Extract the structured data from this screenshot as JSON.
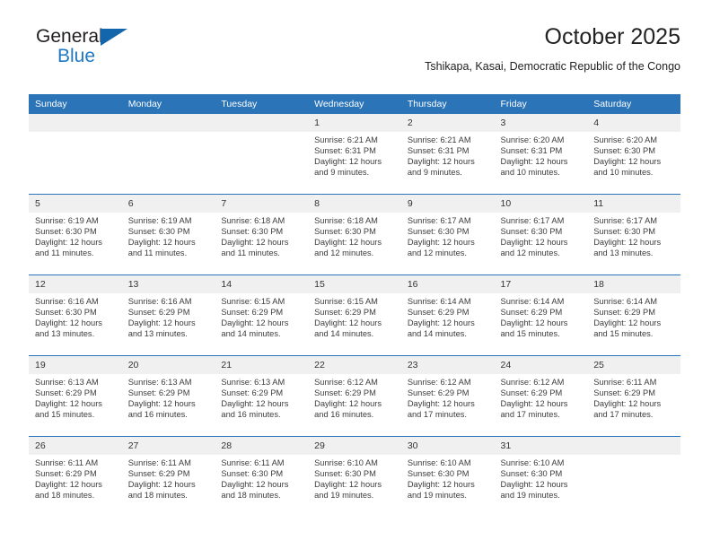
{
  "brand": {
    "name_top": "General",
    "name_bottom": "Blue",
    "accent_color": "#1366ab",
    "text_color": "#231f20",
    "blue_text_color": "#1f78c1"
  },
  "header": {
    "title": "October 2025",
    "subtitle": "Tshikapa, Kasai, Democratic Republic of the Congo"
  },
  "theme": {
    "header_row_bg": "#2b74b8",
    "header_row_text": "#ffffff",
    "daynum_bg": "#f0f0f0",
    "grid_line": "#2b74b8",
    "body_text": "#3c3c3c"
  },
  "weekdays": [
    "Sunday",
    "Monday",
    "Tuesday",
    "Wednesday",
    "Thursday",
    "Friday",
    "Saturday"
  ],
  "weeks": [
    [
      {
        "day": "",
        "sunrise": "",
        "sunset": "",
        "daylight1": "",
        "daylight2": "",
        "empty": true
      },
      {
        "day": "",
        "sunrise": "",
        "sunset": "",
        "daylight1": "",
        "daylight2": "",
        "empty": true
      },
      {
        "day": "",
        "sunrise": "",
        "sunset": "",
        "daylight1": "",
        "daylight2": "",
        "empty": true
      },
      {
        "day": "1",
        "sunrise": "Sunrise: 6:21 AM",
        "sunset": "Sunset: 6:31 PM",
        "daylight1": "Daylight: 12 hours",
        "daylight2": "and 9 minutes."
      },
      {
        "day": "2",
        "sunrise": "Sunrise: 6:21 AM",
        "sunset": "Sunset: 6:31 PM",
        "daylight1": "Daylight: 12 hours",
        "daylight2": "and 9 minutes."
      },
      {
        "day": "3",
        "sunrise": "Sunrise: 6:20 AM",
        "sunset": "Sunset: 6:31 PM",
        "daylight1": "Daylight: 12 hours",
        "daylight2": "and 10 minutes."
      },
      {
        "day": "4",
        "sunrise": "Sunrise: 6:20 AM",
        "sunset": "Sunset: 6:30 PM",
        "daylight1": "Daylight: 12 hours",
        "daylight2": "and 10 minutes."
      }
    ],
    [
      {
        "day": "5",
        "sunrise": "Sunrise: 6:19 AM",
        "sunset": "Sunset: 6:30 PM",
        "daylight1": "Daylight: 12 hours",
        "daylight2": "and 11 minutes."
      },
      {
        "day": "6",
        "sunrise": "Sunrise: 6:19 AM",
        "sunset": "Sunset: 6:30 PM",
        "daylight1": "Daylight: 12 hours",
        "daylight2": "and 11 minutes."
      },
      {
        "day": "7",
        "sunrise": "Sunrise: 6:18 AM",
        "sunset": "Sunset: 6:30 PM",
        "daylight1": "Daylight: 12 hours",
        "daylight2": "and 11 minutes."
      },
      {
        "day": "8",
        "sunrise": "Sunrise: 6:18 AM",
        "sunset": "Sunset: 6:30 PM",
        "daylight1": "Daylight: 12 hours",
        "daylight2": "and 12 minutes."
      },
      {
        "day": "9",
        "sunrise": "Sunrise: 6:17 AM",
        "sunset": "Sunset: 6:30 PM",
        "daylight1": "Daylight: 12 hours",
        "daylight2": "and 12 minutes."
      },
      {
        "day": "10",
        "sunrise": "Sunrise: 6:17 AM",
        "sunset": "Sunset: 6:30 PM",
        "daylight1": "Daylight: 12 hours",
        "daylight2": "and 12 minutes."
      },
      {
        "day": "11",
        "sunrise": "Sunrise: 6:17 AM",
        "sunset": "Sunset: 6:30 PM",
        "daylight1": "Daylight: 12 hours",
        "daylight2": "and 13 minutes."
      }
    ],
    [
      {
        "day": "12",
        "sunrise": "Sunrise: 6:16 AM",
        "sunset": "Sunset: 6:30 PM",
        "daylight1": "Daylight: 12 hours",
        "daylight2": "and 13 minutes."
      },
      {
        "day": "13",
        "sunrise": "Sunrise: 6:16 AM",
        "sunset": "Sunset: 6:29 PM",
        "daylight1": "Daylight: 12 hours",
        "daylight2": "and 13 minutes."
      },
      {
        "day": "14",
        "sunrise": "Sunrise: 6:15 AM",
        "sunset": "Sunset: 6:29 PM",
        "daylight1": "Daylight: 12 hours",
        "daylight2": "and 14 minutes."
      },
      {
        "day": "15",
        "sunrise": "Sunrise: 6:15 AM",
        "sunset": "Sunset: 6:29 PM",
        "daylight1": "Daylight: 12 hours",
        "daylight2": "and 14 minutes."
      },
      {
        "day": "16",
        "sunrise": "Sunrise: 6:14 AM",
        "sunset": "Sunset: 6:29 PM",
        "daylight1": "Daylight: 12 hours",
        "daylight2": "and 14 minutes."
      },
      {
        "day": "17",
        "sunrise": "Sunrise: 6:14 AM",
        "sunset": "Sunset: 6:29 PM",
        "daylight1": "Daylight: 12 hours",
        "daylight2": "and 15 minutes."
      },
      {
        "day": "18",
        "sunrise": "Sunrise: 6:14 AM",
        "sunset": "Sunset: 6:29 PM",
        "daylight1": "Daylight: 12 hours",
        "daylight2": "and 15 minutes."
      }
    ],
    [
      {
        "day": "19",
        "sunrise": "Sunrise: 6:13 AM",
        "sunset": "Sunset: 6:29 PM",
        "daylight1": "Daylight: 12 hours",
        "daylight2": "and 15 minutes."
      },
      {
        "day": "20",
        "sunrise": "Sunrise: 6:13 AM",
        "sunset": "Sunset: 6:29 PM",
        "daylight1": "Daylight: 12 hours",
        "daylight2": "and 16 minutes."
      },
      {
        "day": "21",
        "sunrise": "Sunrise: 6:13 AM",
        "sunset": "Sunset: 6:29 PM",
        "daylight1": "Daylight: 12 hours",
        "daylight2": "and 16 minutes."
      },
      {
        "day": "22",
        "sunrise": "Sunrise: 6:12 AM",
        "sunset": "Sunset: 6:29 PM",
        "daylight1": "Daylight: 12 hours",
        "daylight2": "and 16 minutes."
      },
      {
        "day": "23",
        "sunrise": "Sunrise: 6:12 AM",
        "sunset": "Sunset: 6:29 PM",
        "daylight1": "Daylight: 12 hours",
        "daylight2": "and 17 minutes."
      },
      {
        "day": "24",
        "sunrise": "Sunrise: 6:12 AM",
        "sunset": "Sunset: 6:29 PM",
        "daylight1": "Daylight: 12 hours",
        "daylight2": "and 17 minutes."
      },
      {
        "day": "25",
        "sunrise": "Sunrise: 6:11 AM",
        "sunset": "Sunset: 6:29 PM",
        "daylight1": "Daylight: 12 hours",
        "daylight2": "and 17 minutes."
      }
    ],
    [
      {
        "day": "26",
        "sunrise": "Sunrise: 6:11 AM",
        "sunset": "Sunset: 6:29 PM",
        "daylight1": "Daylight: 12 hours",
        "daylight2": "and 18 minutes."
      },
      {
        "day": "27",
        "sunrise": "Sunrise: 6:11 AM",
        "sunset": "Sunset: 6:29 PM",
        "daylight1": "Daylight: 12 hours",
        "daylight2": "and 18 minutes."
      },
      {
        "day": "28",
        "sunrise": "Sunrise: 6:11 AM",
        "sunset": "Sunset: 6:30 PM",
        "daylight1": "Daylight: 12 hours",
        "daylight2": "and 18 minutes."
      },
      {
        "day": "29",
        "sunrise": "Sunrise: 6:10 AM",
        "sunset": "Sunset: 6:30 PM",
        "daylight1": "Daylight: 12 hours",
        "daylight2": "and 19 minutes."
      },
      {
        "day": "30",
        "sunrise": "Sunrise: 6:10 AM",
        "sunset": "Sunset: 6:30 PM",
        "daylight1": "Daylight: 12 hours",
        "daylight2": "and 19 minutes."
      },
      {
        "day": "31",
        "sunrise": "Sunrise: 6:10 AM",
        "sunset": "Sunset: 6:30 PM",
        "daylight1": "Daylight: 12 hours",
        "daylight2": "and 19 minutes."
      },
      {
        "day": "",
        "sunrise": "",
        "sunset": "",
        "daylight1": "",
        "daylight2": "",
        "empty": true
      }
    ]
  ]
}
